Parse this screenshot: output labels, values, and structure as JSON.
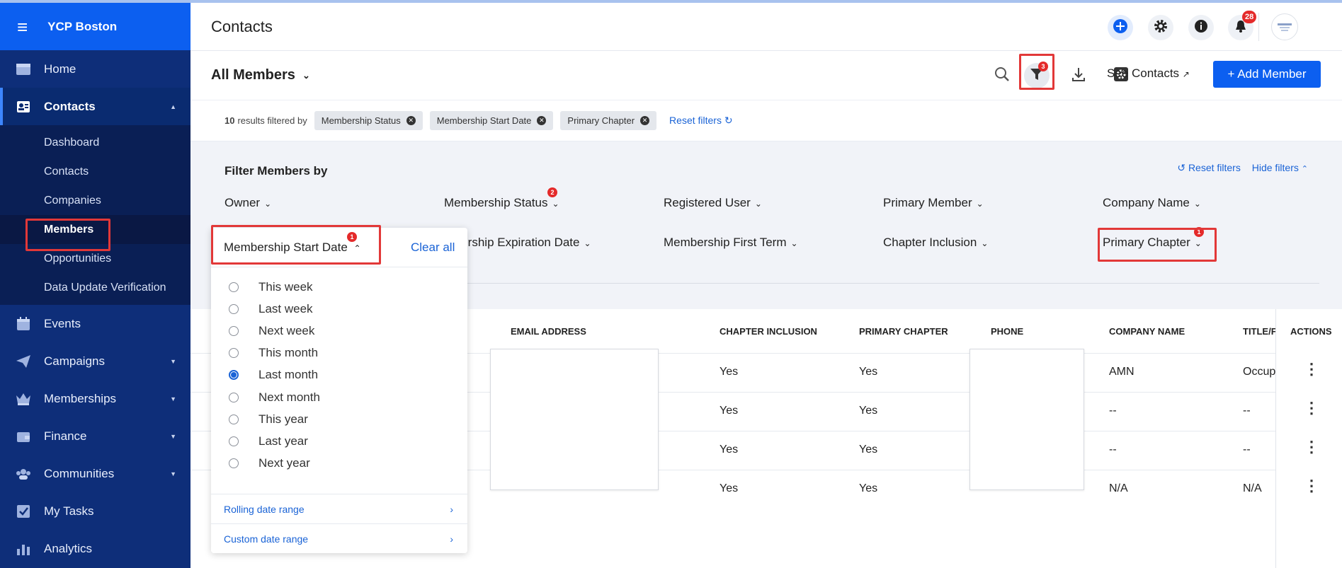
{
  "app": {
    "org_name": "YCP Boston",
    "page_title": "Contacts"
  },
  "sidebar": {
    "items": [
      {
        "label": "Home",
        "icon": "home-icon"
      },
      {
        "label": "Contacts",
        "icon": "contacts-icon",
        "active": true
      },
      {
        "label": "Events",
        "icon": "calendar-icon"
      },
      {
        "label": "Campaigns",
        "icon": "paper-plane-icon"
      },
      {
        "label": "Memberships",
        "icon": "crown-icon"
      },
      {
        "label": "Finance",
        "icon": "wallet-icon"
      },
      {
        "label": "Communities",
        "icon": "people-icon"
      },
      {
        "label": "My Tasks",
        "icon": "checklist-icon"
      },
      {
        "label": "Analytics",
        "icon": "bar-chart-icon"
      }
    ],
    "sub_items": [
      "Dashboard",
      "Contacts",
      "Companies",
      "Members",
      "Opportunities",
      "Data Update Verification"
    ],
    "current_sub": "Members"
  },
  "header": {
    "notifications_count": "28"
  },
  "toolbar": {
    "view_label": "All Members",
    "filter_count": "3",
    "see_contacts_label": "See Contacts",
    "add_member_label": "+ Add Member"
  },
  "filter_summary": {
    "count": "10",
    "text": "results filtered by",
    "chips": [
      "Membership Status",
      "Membership Start Date",
      "Primary Chapter"
    ],
    "reset_label": "Reset filters"
  },
  "filters_panel": {
    "title": "Filter Members by",
    "reset_label": "Reset filters",
    "hide_label": "Hide filters",
    "row1": [
      "Owner",
      "Membership Status",
      "Registered User",
      "Primary Member",
      "Company Name"
    ],
    "row2": [
      "Membership Start Date",
      "Membership Expiration Date",
      "Membership First Term",
      "Chapter Inclusion",
      "Primary Chapter"
    ],
    "membership_status_badge": "2",
    "start_date_badge": "1",
    "primary_chapter_badge": "1"
  },
  "dropdown": {
    "title": "Membership Start Date",
    "clear_label": "Clear all",
    "options": [
      "This week",
      "Last week",
      "Next week",
      "This month",
      "Last month",
      "Next month",
      "This year",
      "Last year",
      "Next year"
    ],
    "selected": "Last month",
    "rolling_label": "Rolling date range",
    "custom_label": "Custom date range"
  },
  "table": {
    "columns": [
      "EMAIL ADDRESS",
      "CHAPTER INCLUSION",
      "PRIMARY CHAPTER",
      "PHONE",
      "COMPANY NAME",
      "TITLE/F",
      "ACTIONS"
    ],
    "rows": [
      {
        "chapter_inclusion": "Yes",
        "primary_chapter": "Yes",
        "company": "AMN",
        "title": "Occup"
      },
      {
        "chapter_inclusion": "Yes",
        "primary_chapter": "Yes",
        "company": "--",
        "title": "--"
      },
      {
        "chapter_inclusion": "Yes",
        "primary_chapter": "Yes",
        "company": "--",
        "title": "--"
      },
      {
        "chapter_inclusion": "Yes",
        "primary_chapter": "Yes",
        "company": "N/A",
        "title": "N/A"
      }
    ]
  }
}
